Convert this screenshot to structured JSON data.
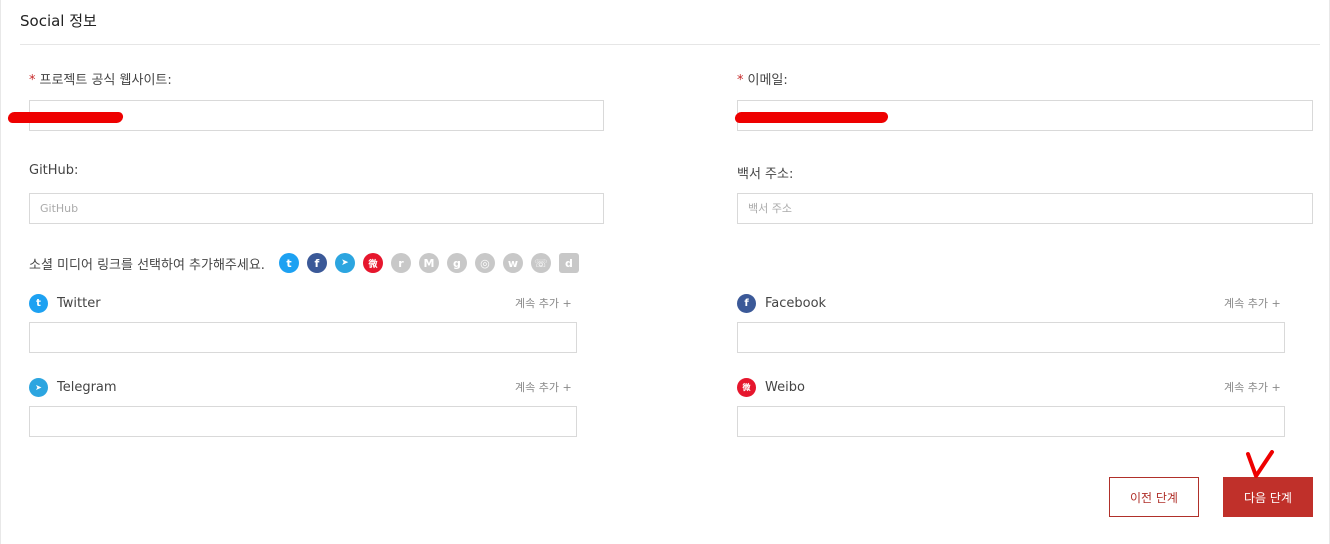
{
  "section": {
    "title": "Social 정보"
  },
  "fields": {
    "website": {
      "label": "프로젝트 공식 웹사이트:",
      "required": true,
      "value": "",
      "redacted": true
    },
    "email": {
      "label": "이메일:",
      "required": true,
      "value": "",
      "redacted": true
    },
    "github": {
      "label": "GitHub:",
      "placeholder": "GitHub",
      "value": ""
    },
    "whitepaper": {
      "label": "백서 주소:",
      "placeholder": "백서 주소",
      "value": ""
    }
  },
  "social": {
    "prompt": "소셜 미디어 링크를 선택하여 추가해주세요.",
    "icons": [
      {
        "name": "twitter-icon",
        "glyph": "t",
        "color": "#1da1f2",
        "selected": true
      },
      {
        "name": "facebook-icon",
        "glyph": "f",
        "color": "#3b5998",
        "selected": true
      },
      {
        "name": "telegram-icon",
        "glyph": "➤",
        "color": "#2ca5e0",
        "selected": true
      },
      {
        "name": "weibo-icon",
        "glyph": "微",
        "color": "#e6162d",
        "selected": true
      },
      {
        "name": "reddit-icon",
        "glyph": "r",
        "color": "#c8c8c8",
        "selected": false
      },
      {
        "name": "medium-icon",
        "glyph": "M",
        "color": "#c8c8c8",
        "selected": false
      },
      {
        "name": "github-icon",
        "glyph": "g",
        "color": "#c8c8c8",
        "selected": false
      },
      {
        "name": "instagram-icon",
        "glyph": "◎",
        "color": "#c8c8c8",
        "selected": false
      },
      {
        "name": "wechat-icon",
        "glyph": "w",
        "color": "#c8c8c8",
        "selected": false
      },
      {
        "name": "whatsapp-icon",
        "glyph": "☏",
        "color": "#c8c8c8",
        "selected": false
      },
      {
        "name": "discord-icon",
        "glyph": "d",
        "color": "#c8c8c8",
        "selected": false
      }
    ],
    "more_label": "계속 추가 +",
    "rows": {
      "twitter": {
        "label": "Twitter",
        "color": "#1da1f2",
        "value": ""
      },
      "facebook": {
        "label": "Facebook",
        "color": "#3b5998",
        "value": ""
      },
      "telegram": {
        "label": "Telegram",
        "color": "#2ca5e0",
        "value": ""
      },
      "weibo": {
        "label": "Weibo",
        "color": "#e6162d",
        "value": ""
      }
    }
  },
  "buttons": {
    "prev": "이전 단계",
    "next": "다음 단계"
  },
  "colors": {
    "accent": "#c0302a",
    "required": "#c62828",
    "redaction": "#ee0000"
  }
}
